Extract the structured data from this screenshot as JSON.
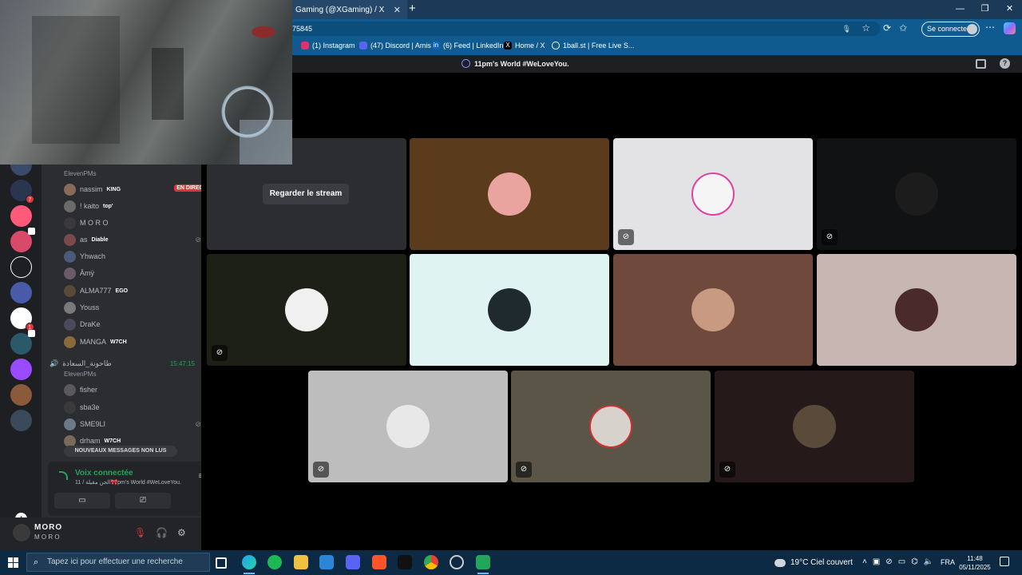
{
  "browser": {
    "tab_title": "Gaming (@XGaming) / X",
    "tab_close": "✕",
    "new_tab": "+",
    "url_partial": "75845",
    "signin_label": "Se connecter",
    "bookmarks": [
      {
        "label": "(1) Instagram",
        "icon": "instagram-icon",
        "color": "#e1306c"
      },
      {
        "label": "(47) Discord | Amis",
        "icon": "discord-icon",
        "color": "#5865f2"
      },
      {
        "label": "(6) Feed | LinkedIn",
        "icon": "linkedin-icon",
        "color": "#0a66c2"
      },
      {
        "label": "Home / X",
        "icon": "x-icon",
        "color": "#000000"
      },
      {
        "label": "1ball.st | Free Live S...",
        "icon": "globe-icon",
        "color": "#5f6b78"
      }
    ]
  },
  "discord": {
    "server_title": "11pm's World #WeLoveYou.",
    "channels": {
      "channel1_sub": "ElevenPMs",
      "members1": [
        {
          "name": "nassim",
          "tag": "KING",
          "live": "EN DIRECT",
          "color": "#8a6a5a"
        },
        {
          "name": "! kaito",
          "tag": "top'",
          "color": "#6a6a6a"
        },
        {
          "name": "M O R O",
          "tag": "",
          "color": "#3a3a3a"
        },
        {
          "name": "as",
          "tag": "Diable",
          "color": "#7a4a4a"
        },
        {
          "name": "Yhwach",
          "tag": "",
          "color": "#4a5a7a"
        },
        {
          "name": "Âmÿ",
          "tag": "",
          "color": "#6a5a6a"
        },
        {
          "name": "ALMA777",
          "tag": "EGO",
          "color": "#5a4a3a"
        },
        {
          "name": "Youss",
          "tag": "",
          "color": "#7a7a7a"
        },
        {
          "name": "DraKe",
          "tag": "",
          "color": "#4a4a5a"
        },
        {
          "name": "MANGA",
          "tag": "W7CH",
          "color": "#8a6a3a"
        }
      ],
      "channel2_name": "طاحونة_السعادة",
      "channel2_time": "15:47:15",
      "channel2_sub": "ElevenPMs",
      "members2": [
        {
          "name": "fisher",
          "tag": "",
          "color": "#5a5a5a"
        },
        {
          "name": "sba3e",
          "tag": "",
          "color": "#3a3a3a"
        },
        {
          "name": "SME9LI",
          "tag": "",
          "color": "#6a7a8a"
        },
        {
          "name": "drham",
          "tag": "W7CH",
          "color": "#7a6a5a"
        }
      ],
      "new_messages": "NOUVEAUX MESSAGES NON LUS"
    },
    "voice": {
      "status": "Voix connectée",
      "location": "11 / الجن مقيلة🎀pm's World #WeLoveYou."
    },
    "user": {
      "name": "MORO",
      "status": "M O R O"
    },
    "stage": {
      "watch_button": "Regarder le stream",
      "tiles": [
        {
          "bg": "#2b2d31",
          "avatar": "",
          "muted": false,
          "stream": true
        },
        {
          "bg": "#5a3c1c",
          "avatar": "#e9a4a0",
          "muted": false
        },
        {
          "bg": "#e3e3e6",
          "avatar": "#f5f5f5",
          "muted": true
        },
        {
          "bg": "#111214",
          "avatar": "#1c1c1c",
          "muted": true
        },
        {
          "bg": "#1d2016",
          "avatar": "#f0f0f0",
          "muted": true
        },
        {
          "bg": "#dff3f3",
          "avatar": "#1e2a2e",
          "muted": false
        },
        {
          "bg": "#6f4a3c",
          "avatar": "#c89a82",
          "muted": false
        },
        {
          "bg": "#c7b6b2",
          "avatar": "#4a2a2a",
          "muted": false
        },
        {
          "bg": "#bdbdbd",
          "avatar": "#e8e8e8",
          "muted": true
        },
        {
          "bg": "#5a5547",
          "avatar": "#d8d2cc",
          "muted": true
        },
        {
          "bg": "#25191a",
          "avatar": "#5a4a3a",
          "muted": true
        }
      ]
    }
  },
  "taskbar": {
    "search_placeholder": "Tapez ici pour effectuer une recherche",
    "weather": "19°C  Ciel couvert",
    "lang": "FRA",
    "time": "11:48",
    "date": "05/11/2025"
  }
}
